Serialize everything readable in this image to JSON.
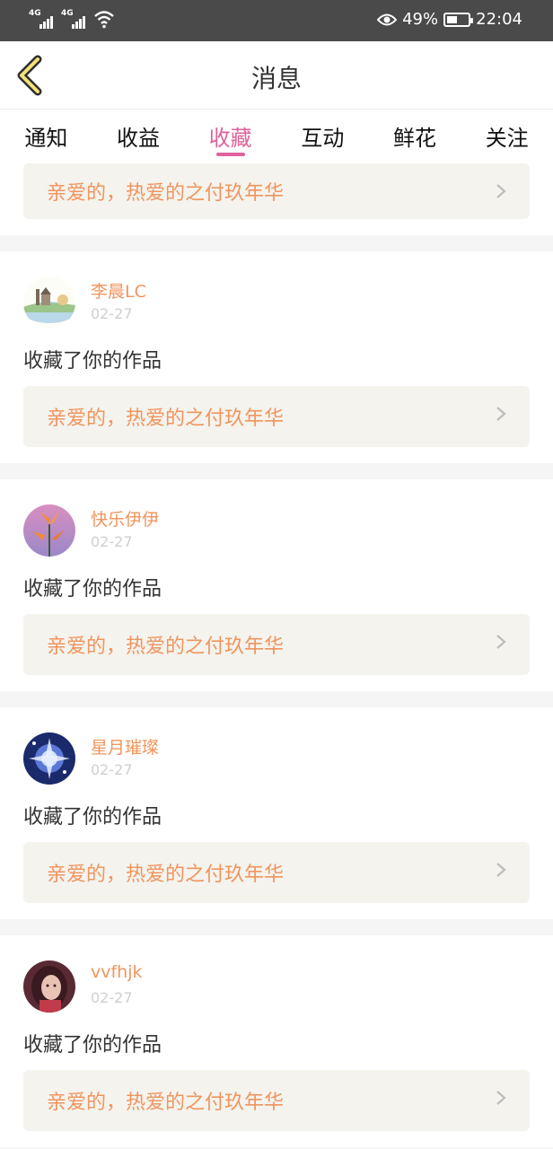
{
  "status_bar": {
    "signal1_label": "4G",
    "signal2_label": "4G",
    "battery_percent": "49%",
    "battery_level": 0.49,
    "time": "22:04"
  },
  "header": {
    "title": "消息",
    "back_icon": "chevron-left-icon"
  },
  "tabs": [
    {
      "label": "通知",
      "active": false
    },
    {
      "label": "收益",
      "active": false
    },
    {
      "label": "收藏",
      "active": true
    },
    {
      "label": "互动",
      "active": false
    },
    {
      "label": "鲜花",
      "active": false
    },
    {
      "label": "关注",
      "active": false
    }
  ],
  "partial_item": {
    "work_title": "亲爱的，热爱的之付玖年华"
  },
  "items": [
    {
      "user": "李晨LC",
      "date": "02-27",
      "action": "收藏了你的作品",
      "work_title": "亲爱的，热爱的之付玖年华",
      "avatar": "landscape"
    },
    {
      "user": "快乐伊伊",
      "date": "02-27",
      "action": "收藏了你的作品",
      "work_title": "亲爱的，热爱的之付玖年华",
      "avatar": "flower"
    },
    {
      "user": "星月璀璨",
      "date": "02-27",
      "action": "收藏了你的作品",
      "work_title": "亲爱的，热爱的之付玖年华",
      "avatar": "sparkle"
    },
    {
      "user": "vvfhjk",
      "date": "02-27",
      "action": "收藏了你的作品",
      "work_title": "亲爱的，热爱的之付玖年华",
      "avatar": "portrait"
    }
  ],
  "colors": {
    "accent": "#e0629c",
    "link_text": "#f0955e",
    "card_bg": "#f4f3ee"
  }
}
